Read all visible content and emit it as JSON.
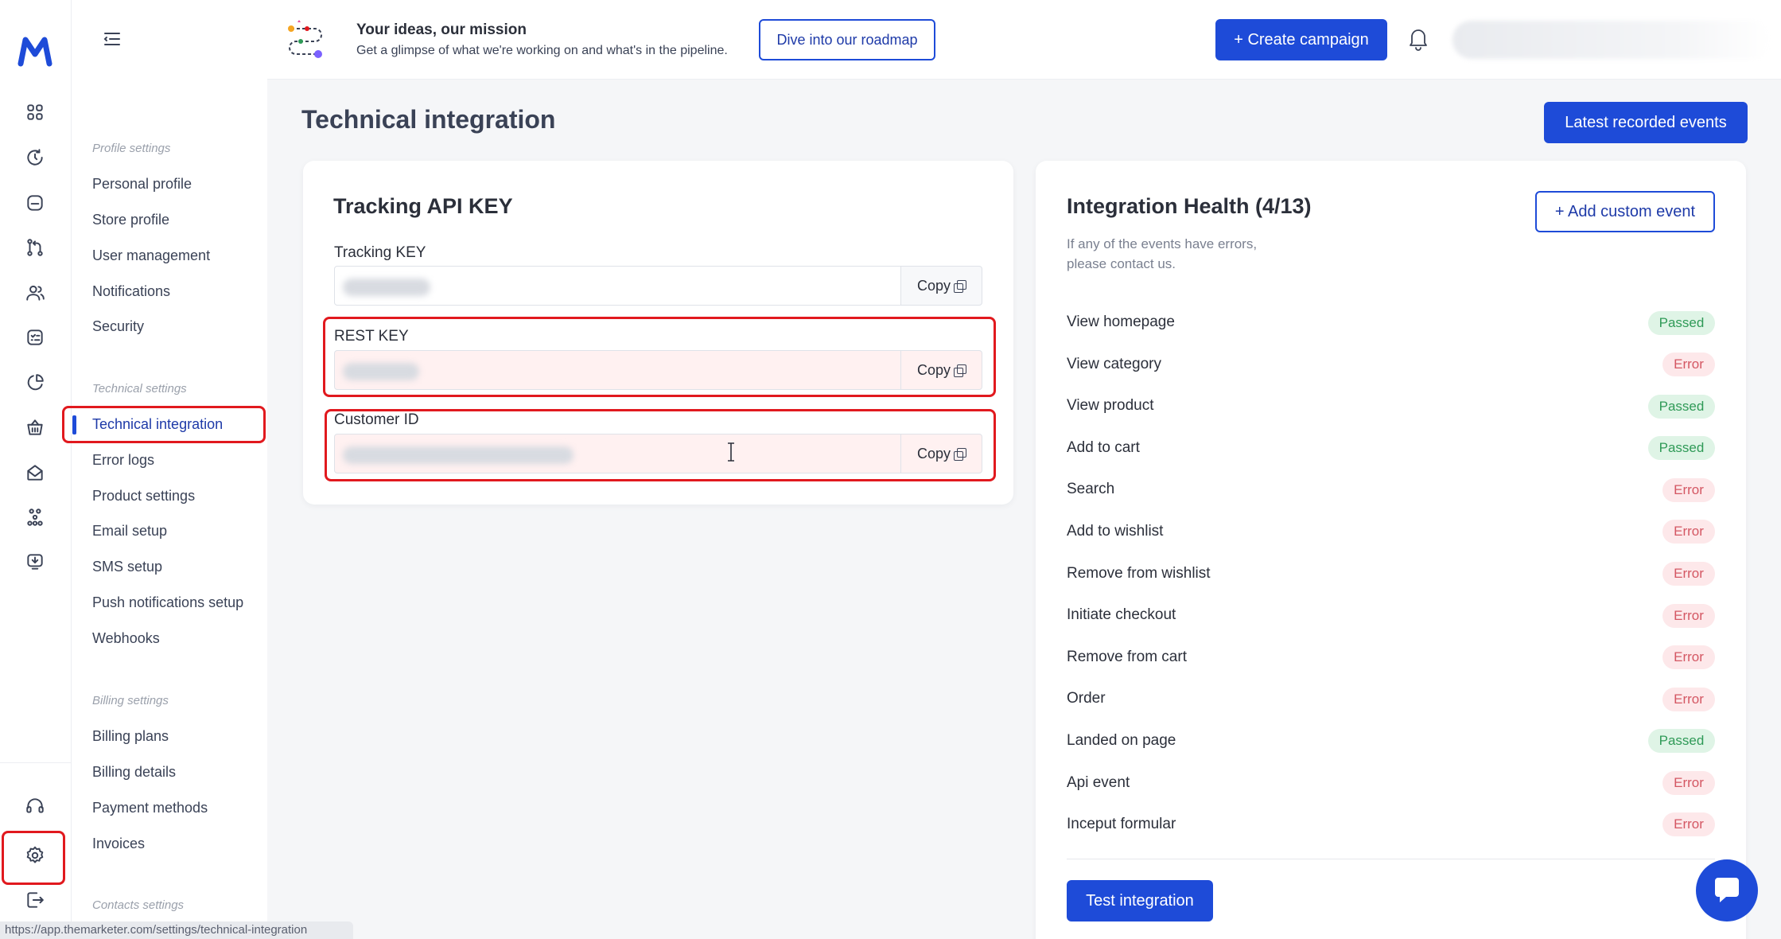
{
  "topbar": {
    "roadmap_title": "Your ideas, our mission",
    "roadmap_subtitle": "Get a glimpse of what we're working on and what's in the pipeline.",
    "roadmap_button": "Dive into our roadmap",
    "create_campaign": "+ Create campaign"
  },
  "sidebar": {
    "groups": [
      {
        "title": "Profile settings",
        "items": [
          "Personal profile",
          "Store profile",
          "User management",
          "Notifications",
          "Security"
        ]
      },
      {
        "title": "Technical settings",
        "items": [
          "Technical integration",
          "Error logs",
          "Product settings",
          "Email setup",
          "SMS setup",
          "Push notifications setup",
          "Webhooks"
        ]
      },
      {
        "title": "Billing settings",
        "items": [
          "Billing plans",
          "Billing details",
          "Payment methods",
          "Invoices"
        ]
      },
      {
        "title": "Contacts settings",
        "items": []
      }
    ],
    "active_item": "Technical integration"
  },
  "page": {
    "title": "Technical integration",
    "latest_events_button": "Latest recorded events"
  },
  "tracking": {
    "title": "Tracking API KEY",
    "fields": [
      {
        "label": "Tracking KEY",
        "copy": "Copy"
      },
      {
        "label": "REST KEY",
        "copy": "Copy"
      },
      {
        "label": "Customer ID",
        "copy": "Copy"
      }
    ]
  },
  "health": {
    "title": "Integration Health (4/13)",
    "subtitle": "If any of the events have errors, please contact us.",
    "add_custom_event": "+ Add custom event",
    "events": [
      {
        "name": "View homepage",
        "status": "Passed"
      },
      {
        "name": "View category",
        "status": "Error"
      },
      {
        "name": "View product",
        "status": "Passed"
      },
      {
        "name": "Add to cart",
        "status": "Passed"
      },
      {
        "name": "Search",
        "status": "Error"
      },
      {
        "name": "Add to wishlist",
        "status": "Error"
      },
      {
        "name": "Remove from wishlist",
        "status": "Error"
      },
      {
        "name": "Initiate checkout",
        "status": "Error"
      },
      {
        "name": "Remove from cart",
        "status": "Error"
      },
      {
        "name": "Order",
        "status": "Error"
      },
      {
        "name": "Landed on page",
        "status": "Passed"
      },
      {
        "name": "Api event",
        "status": "Error"
      },
      {
        "name": "Inceput formular",
        "status": "Error"
      }
    ],
    "test_button": "Test integration"
  },
  "status_bar_url": "https://app.themarketer.com/settings/technical-integration",
  "rail_icons": [
    "dashboard-icon",
    "clock-refresh-icon",
    "inbox-icon",
    "workflow-icon",
    "contacts-icon",
    "checklist-icon",
    "pie-chart-icon",
    "basket-icon",
    "mail-open-icon",
    "network-icon",
    "download-monitor-icon",
    "headset-icon",
    "gear-icon",
    "logout-icon"
  ],
  "colors": {
    "accent": "#1e4bd8",
    "highlight": "#e1191e",
    "passed": "#2f9a57",
    "error": "#d45763"
  }
}
